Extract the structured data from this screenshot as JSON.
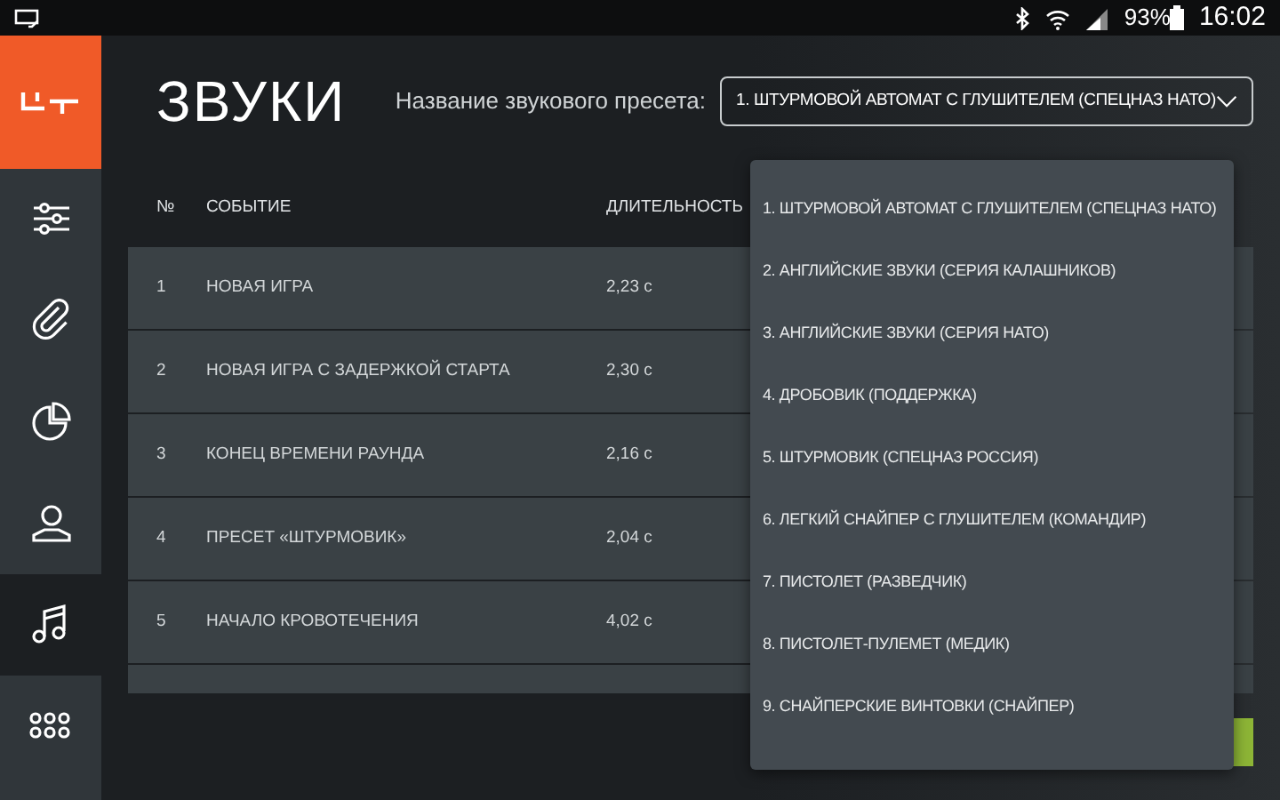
{
  "status_bar": {
    "battery": "93%",
    "time": "16:02"
  },
  "sidebar": {
    "items": [
      {
        "kind": "sliders",
        "selected": false
      },
      {
        "kind": "clip",
        "selected": false
      },
      {
        "kind": "pie",
        "selected": false
      },
      {
        "kind": "person",
        "selected": false
      },
      {
        "kind": "music",
        "selected": true
      },
      {
        "kind": "dots",
        "selected": false
      }
    ]
  },
  "header": {
    "title": "ЗВУКИ",
    "preset_label": "Название звукового пресета:",
    "preset_value": "1. ШТУРМОВОЙ АВТОМАТ С ГЛУШИТЕЛЕМ (СПЕЦНАЗ НАТО)"
  },
  "table": {
    "columns": [
      "№",
      "СОБЫТИЕ",
      "ДЛИТЕЛЬНОСТЬ"
    ],
    "rows": [
      {
        "number": "1",
        "event": "НОВАЯ ИГРА",
        "duration": "2,23 с"
      },
      {
        "number": "2",
        "event": "НОВАЯ ИГРА С ЗАДЕРЖКОЙ СТАРТА",
        "duration": "2,30 с"
      },
      {
        "number": "3",
        "event": "КОНЕЦ ВРЕМЕНИ РАУНДА",
        "duration": "2,16 с"
      },
      {
        "number": "4",
        "event": "ПРЕСЕТ «ШТУРМОВИК»",
        "duration": "2,04 с"
      },
      {
        "number": "5",
        "event": "НАЧАЛО КРОВОТЕЧЕНИЯ",
        "duration": "4,02 с"
      }
    ]
  },
  "dropdown": {
    "expanded": true,
    "options": [
      "1. ШТУРМОВОЙ АВТОМАТ С ГЛУШИТЕЛЕМ (СПЕЦНАЗ НАТО)",
      "2. АНГЛИЙСКИЕ ЗВУКИ (СЕРИЯ КАЛАШНИКОВ)",
      "3. АНГЛИЙСКИЕ ЗВУКИ (СЕРИЯ НАТО)",
      "4. ДРОБОВИК (ПОДДЕРЖКА)",
      "5. ШТУРМОВИК (СПЕЦНАЗ РОССИЯ)",
      "6. ЛЕГКИЙ СНАЙПЕР С ГЛУШИТЕЛЕМ (КОМАНДИР)",
      "7. ПИСТОЛЕТ (РАЗВЕДЧИК)",
      "8. ПИСТОЛЕТ-ПУЛЕМЕТ (МЕДИК)",
      "9. СНАЙПЕРСКИЕ ВИНТОВКИ (СНАЙПЕР)"
    ]
  }
}
